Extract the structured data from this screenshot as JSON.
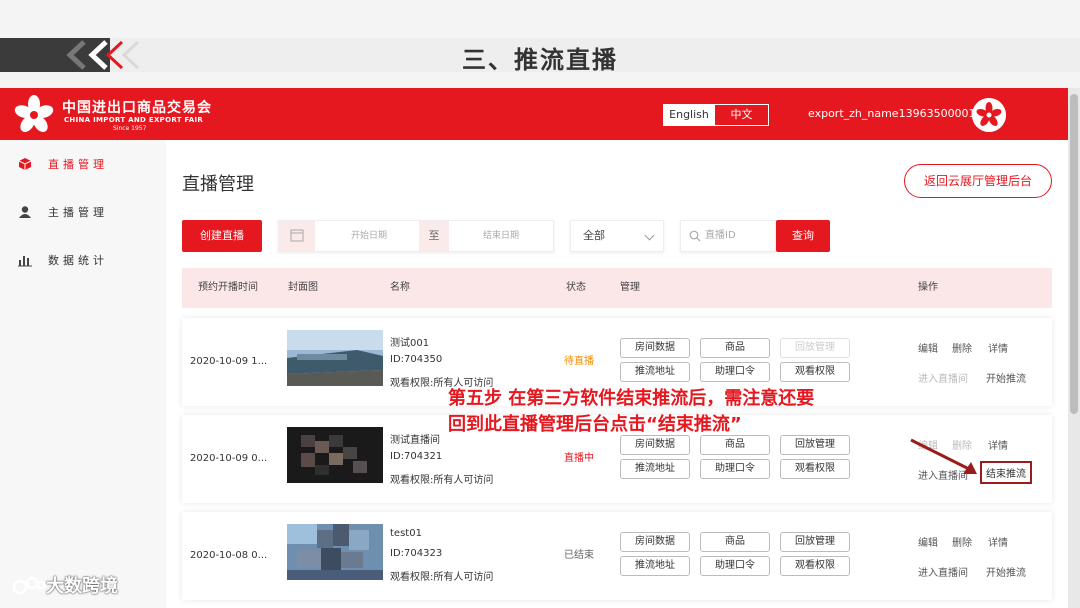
{
  "slide": {
    "title": "三、推流直播"
  },
  "header": {
    "logo_cn": "中国进出口商品交易会",
    "logo_en": "CHINA IMPORT AND EXPORT FAIR",
    "logo_since": "Since 1957",
    "lang_en": "English",
    "lang_zh": "中文",
    "username": "export_zh_name13963500001"
  },
  "sidebar": {
    "items": [
      {
        "label": "直播管理",
        "icon": "cube-icon"
      },
      {
        "label": "主播管理",
        "icon": "user-icon"
      },
      {
        "label": "数据统计",
        "icon": "bar-chart-icon"
      }
    ]
  },
  "main": {
    "title": "直播管理",
    "back_button": "返回云展厅管理后台",
    "create_button": "创建直播",
    "start_date_placeholder": "开始日期",
    "date_separator": "至",
    "end_date_placeholder": "结束日期",
    "status_select": "全部",
    "search_placeholder": "直播ID",
    "query_button": "查询"
  },
  "table": {
    "headers": [
      "预约开播时间",
      "封面图",
      "名称",
      "状态",
      "管理",
      "操作"
    ],
    "rows": [
      {
        "time": "2020-10-09 1...",
        "name": "测试001",
        "id": "ID:704350",
        "perm": "观看权限:所有人可访问",
        "status": "待直播",
        "manage": [
          "房间数据",
          "商品",
          "回放管理",
          "推流地址",
          "助理口令",
          "观看权限"
        ],
        "ops": [
          "编辑",
          "删除",
          "详情",
          "进入直播间",
          "开始推流"
        ]
      },
      {
        "time": "2020-10-09 0...",
        "name": "测试直播间",
        "id": "ID:704321",
        "perm": "观看权限:所有人可访问",
        "status": "直播中",
        "manage": [
          "房间数据",
          "商品",
          "回放管理",
          "推流地址",
          "助理口令",
          "观看权限"
        ],
        "ops": [
          "编辑",
          "删除",
          "详情",
          "进入直播间",
          "结束推流"
        ]
      },
      {
        "time": "2020-10-08 0...",
        "name": "test01",
        "id": "ID:704323",
        "perm": "观看权限:所有人可访问",
        "status": "已结束",
        "manage": [
          "房间数据",
          "商品",
          "回放管理",
          "推流地址",
          "助理口令",
          "观看权限"
        ],
        "ops": [
          "编辑",
          "删除",
          "详情",
          "进入直播间",
          "开始推流"
        ]
      }
    ]
  },
  "annotation": {
    "line1": "第五步  在第三方软件结束推流后，需注意还要",
    "line2": "回到此直播管理后台点击“结束推流”"
  },
  "watermark": "大数跨境",
  "colors": {
    "brand_red": "#e5171f",
    "pending": "#f08c00",
    "live": "#e5171f",
    "ended": "#666666"
  }
}
